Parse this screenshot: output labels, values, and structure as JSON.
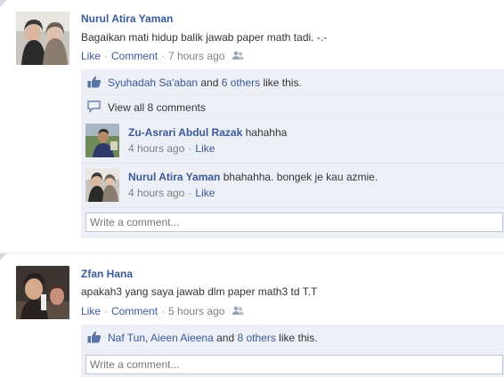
{
  "posts": [
    {
      "author": "Nurul Atira Yaman",
      "message": "Bagaikan mati hidup balik jawab paper math tadi. -.-",
      "like_label": "Like",
      "comment_label": "Comment",
      "timestamp": "7 hours ago",
      "likes": {
        "name1": "Syuhadah Sa'aban",
        "and1": " and ",
        "others": "6 others",
        "suffix": " like this."
      },
      "view_all": "View all 8 comments",
      "comments": [
        {
          "author": "Zu-Asrari Abdul Razak",
          "text": "hahahha",
          "timestamp": "4 hours ago",
          "like_label": "Like"
        },
        {
          "author": "Nurul Atira Yaman",
          "text": "bhahahha. bongek je kau azmie.",
          "timestamp": "4 hours ago",
          "like_label": "Like"
        }
      ],
      "write_placeholder": "Write a comment..."
    },
    {
      "author": "Zfan Hana",
      "message": "apakah3 yang saya jawab dlm paper math3 td T.T",
      "like_label": "Like",
      "comment_label": "Comment",
      "timestamp": "5 hours ago",
      "likes": {
        "name1": "Naf Tun",
        "sep": ", ",
        "name2": "Aieen Aieena",
        "and1": " and ",
        "others": "8 others",
        "suffix": " like this."
      },
      "write_placeholder": "Write a comment..."
    }
  ],
  "colors": {
    "link": "#3b5998",
    "ufi_background": "#eceff5",
    "meta_text": "#7f7f7f"
  },
  "icons": [
    "thumbs-up-icon",
    "comment-bubble-icon",
    "friends-audience-icon"
  ]
}
